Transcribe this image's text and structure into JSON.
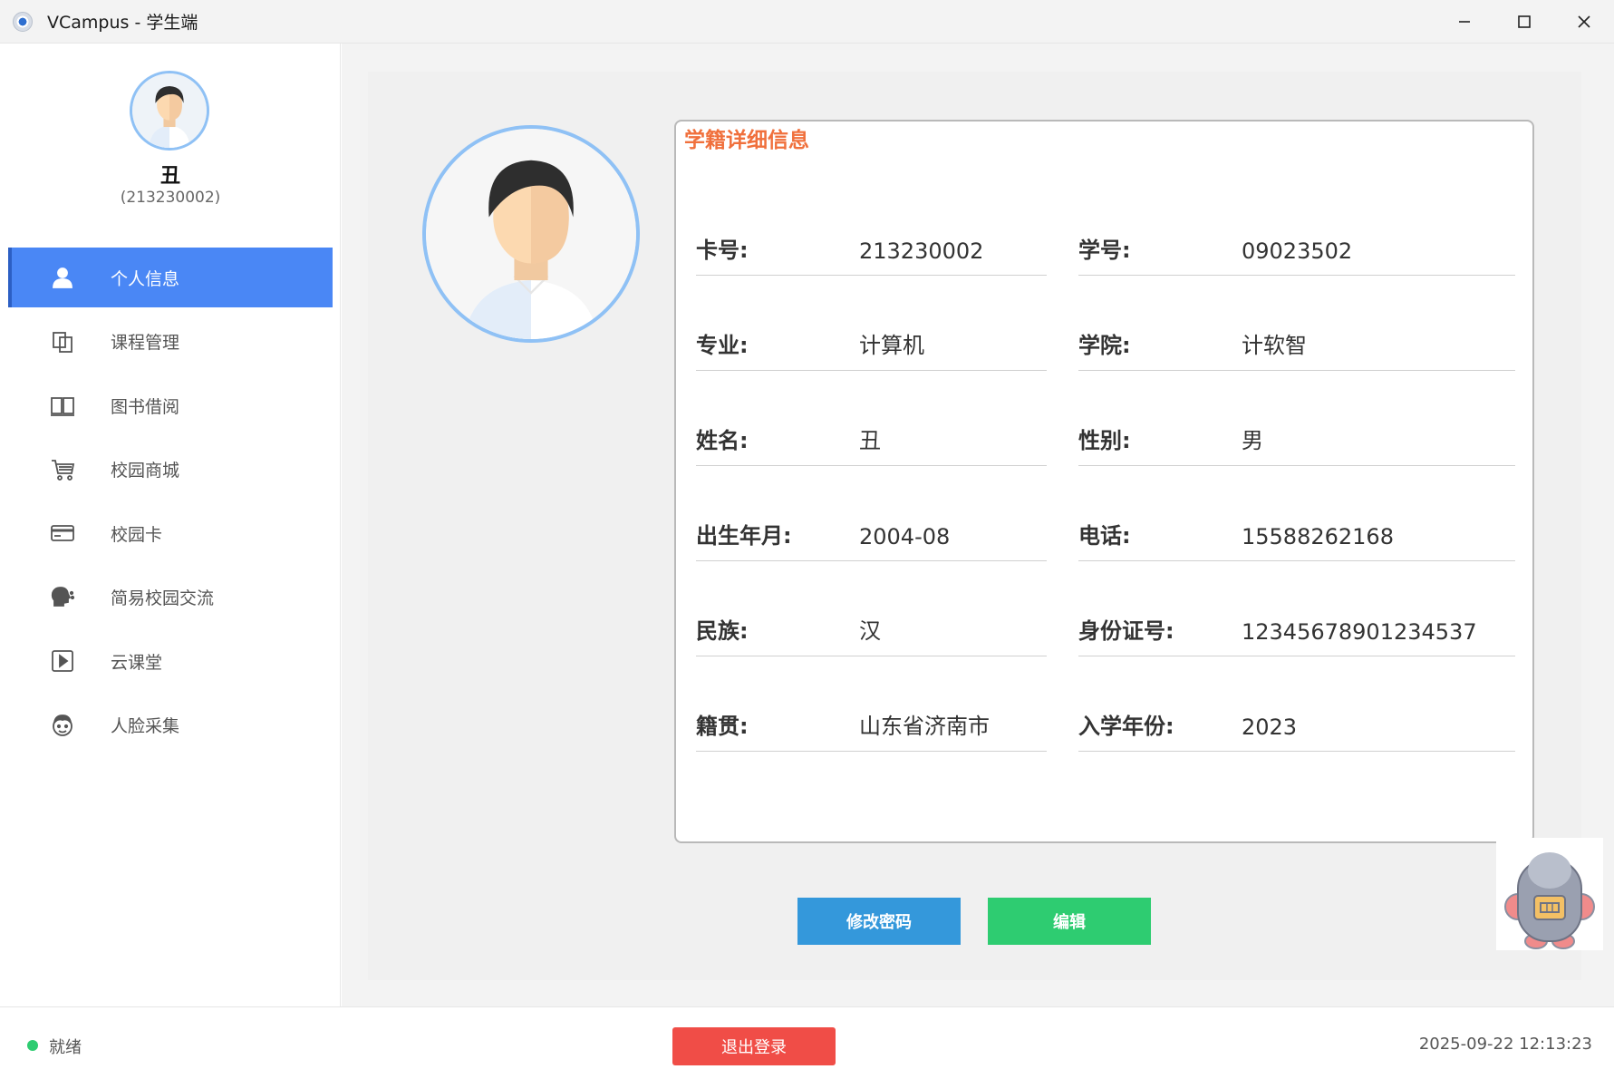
{
  "window": {
    "title": "VCampus - 学生端"
  },
  "sidebar": {
    "user_name": "丑",
    "user_id": "(213230002)",
    "items": [
      {
        "label": "个人信息",
        "icon": "person-icon",
        "active": true
      },
      {
        "label": "课程管理",
        "icon": "copy-pages-icon",
        "active": false
      },
      {
        "label": "图书借阅",
        "icon": "book-icon",
        "active": false
      },
      {
        "label": "校园商城",
        "icon": "cart-icon",
        "active": false
      },
      {
        "label": "校园卡",
        "icon": "card-icon",
        "active": false
      },
      {
        "label": "简易校园交流",
        "icon": "chat-head-icon",
        "active": false
      },
      {
        "label": "云课堂",
        "icon": "play-icon",
        "active": false
      },
      {
        "label": "人脸采集",
        "icon": "face-icon",
        "active": false
      }
    ]
  },
  "info": {
    "title": "学籍详细信息",
    "fields": [
      {
        "label": "卡号:",
        "value": "213230002"
      },
      {
        "label": "学号:",
        "value": "09023502"
      },
      {
        "label": "专业:",
        "value": "计算机"
      },
      {
        "label": "学院:",
        "value": "计软智"
      },
      {
        "label": "姓名:",
        "value": "丑"
      },
      {
        "label": "性别:",
        "value": "男"
      },
      {
        "label": "出生年月:",
        "value": "2004-08"
      },
      {
        "label": "电话:",
        "value": "15588262168"
      },
      {
        "label": "民族:",
        "value": "汉"
      },
      {
        "label": "身份证号:",
        "value": "12345678901234537"
      },
      {
        "label": "籍贯:",
        "value": "山东省济南市"
      },
      {
        "label": "入学年份:",
        "value": "2023"
      }
    ]
  },
  "actions": {
    "change_password": "修改密码",
    "edit": "编辑"
  },
  "status": {
    "text": "就绪",
    "logout": "退出登录",
    "datetime": "2025-09-22 12:13:23"
  },
  "colors": {
    "accent": "#4a87f5",
    "title_orange": "#f0703c",
    "btn_blue": "#3498db",
    "btn_green": "#2ecc71",
    "logout_red": "#f04d47"
  }
}
